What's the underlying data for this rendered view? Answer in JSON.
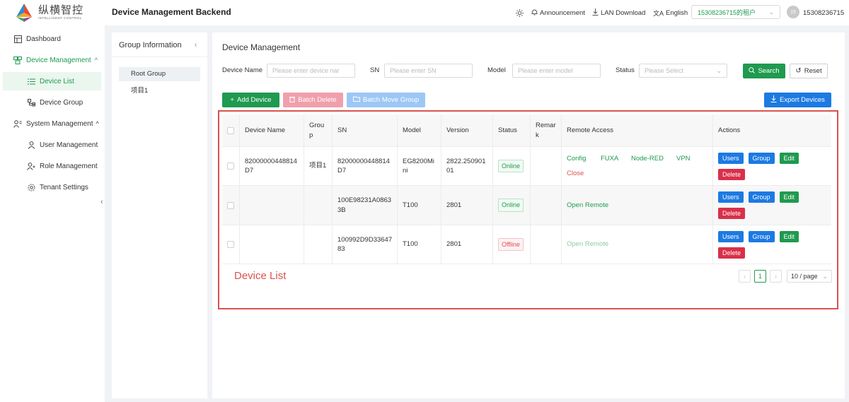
{
  "app": {
    "logo_cn": "纵横智控",
    "logo_en": "INTELLIGENT CONTROL",
    "title": "Device Management Backend"
  },
  "sidebar": {
    "items": [
      {
        "label": "Dashboard",
        "icon": "dashboard-icon"
      },
      {
        "label": "Device Management",
        "icon": "device-management-icon",
        "expanded": true
      },
      {
        "label": "Device List",
        "icon": "list-icon",
        "active": true
      },
      {
        "label": "Device Group",
        "icon": "device-group-icon"
      },
      {
        "label": "System Management",
        "icon": "system-management-icon",
        "expanded": true
      },
      {
        "label": "User Management",
        "icon": "user-icon"
      },
      {
        "label": "Role Management",
        "icon": "role-icon"
      },
      {
        "label": "Tenant Settings",
        "icon": "gear-icon"
      }
    ]
  },
  "header": {
    "announcement": "Announcement",
    "lan_download": "LAN Download",
    "language": "English",
    "tenant": "15308236715的租户",
    "avatar_initials": "15",
    "username": "15308236715"
  },
  "group_panel": {
    "title": "Group Information",
    "items": [
      "Root Group",
      "项目1"
    ]
  },
  "main": {
    "title": "Device Management",
    "filters": {
      "device_name_label": "Device Name",
      "device_name_placeholder": "Please enter device nar",
      "sn_label": "SN",
      "sn_placeholder": "Please enter SN",
      "model_label": "Model",
      "model_placeholder": "Please enter model",
      "status_label": "Status",
      "status_placeholder": "Please Select",
      "search": "Search",
      "reset": "Reset"
    },
    "toolbar": {
      "add": "Add Device",
      "batch_delete": "Batch Delete",
      "batch_move": "Batch Move Group",
      "export": "Export Devices"
    },
    "table": {
      "headers": [
        "Device Name",
        "Grou\np",
        "SN",
        "Model",
        "Version",
        "Status",
        "Remar\nk",
        "Remote Access",
        "Actions"
      ],
      "rows": [
        {
          "name": "82000000448814\nD7",
          "group": "项目1",
          "sn": "82000000448814\nD7",
          "model": "EG8200Mi\nni",
          "version": "2822.250901\n01",
          "status": "Online",
          "remark": ""
        },
        {
          "name": "",
          "group": "",
          "sn": "100E98231A0863\n3B",
          "model": "T100",
          "version": "2801",
          "status": "Online",
          "remark": ""
        },
        {
          "name": "",
          "group": "",
          "sn": "100992D9D33647\n83",
          "model": "T100",
          "version": "2801",
          "status": "Offline",
          "remark": ""
        }
      ],
      "remote": {
        "config": "Config",
        "fuxa": "FUXA",
        "nodered": "Node-RED",
        "vpn": "VPN",
        "close": "Close",
        "open_remote": "Open Remote"
      },
      "actions": {
        "users": "Users",
        "group": "Group",
        "edit": "Edit",
        "delete": "Delete"
      }
    },
    "annotation": "Device List",
    "pagination": {
      "current": "1",
      "page_size": "10 / page"
    }
  },
  "colors": {
    "accent": "#1f9a4f",
    "primary_blue": "#1d7ae2",
    "danger": "#d9304a",
    "annotation_red": "#d9534f"
  }
}
